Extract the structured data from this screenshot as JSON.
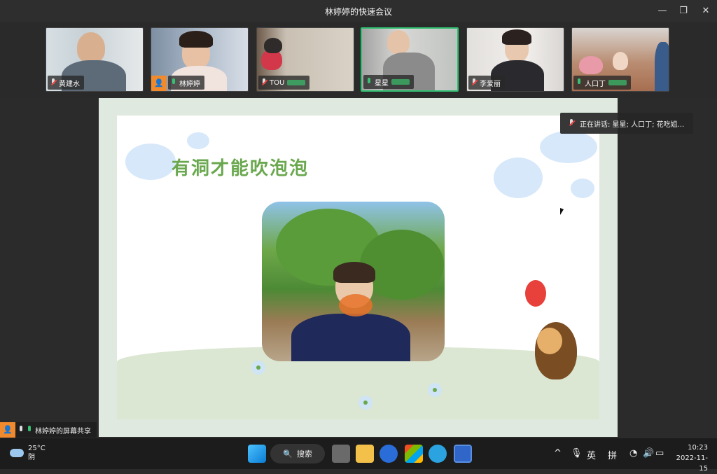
{
  "window": {
    "title": "林婷婷的快速会议",
    "minimize_icon": "—",
    "maximize_icon": "❐",
    "close_icon": "✕"
  },
  "participants": [
    {
      "name": "黄建水",
      "mic": "off"
    },
    {
      "name": "林婷婷",
      "mic": "on",
      "host": true
    },
    {
      "name": "TOU",
      "mic": "off"
    },
    {
      "name": "星星",
      "mic": "on",
      "active": true
    },
    {
      "name": "李爱丽",
      "mic": "off"
    },
    {
      "name": "人口丁",
      "mic": "on"
    }
  ],
  "speaking": {
    "label": "正在讲话: 星星; 人口丁; 花吃姐..."
  },
  "slide": {
    "title": "有洞才能吹泡泡"
  },
  "share": {
    "label": "林婷婷的屏幕共享",
    "host_icon": "👤"
  },
  "taskbar": {
    "weather_temp": "25°C",
    "weather_desc": "阴",
    "search_label": "搜索",
    "search_icon": "🔍",
    "ime_lang": "英",
    "ime_mode": "拼",
    "time": "10:23",
    "date": "2022-11-15"
  }
}
